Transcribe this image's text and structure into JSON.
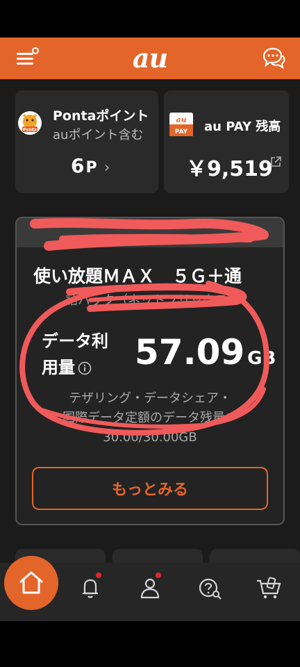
{
  "header": {
    "logo": "au",
    "menu_icon": "hamburger-menu-icon",
    "chat_icon": "chat-bubbles-icon"
  },
  "ponta": {
    "title": "Pontaポイント",
    "subtitle": "auポイント含む",
    "points": "6",
    "unit": "P",
    "chevron": "›",
    "icon_label": "Ponta"
  },
  "aupay": {
    "title": "au PAY 残高",
    "balance": "￥9,519",
    "icon_top": "au",
    "icon_bottom": "PAY"
  },
  "plan": {
    "name": "使い放題ＭＡＸ　５Ｇ＋通",
    "name_line2": "話パック（ネットフリックス",
    "data_label_line1": "データ利",
    "data_label_line2": "用量",
    "data_value": "57.09",
    "data_unit": "GB",
    "share_note_line1": "テザリング・データシェア・",
    "share_note_line2": "国際データ定額のデータ残量：",
    "share_note_line3": "30.00/30.00GB",
    "more_button": "もっとみる"
  },
  "nav": {
    "items": [
      "home-icon",
      "bell-icon",
      "person-icon",
      "help-search-icon",
      "shopping-cart-icon"
    ]
  },
  "colors": {
    "brand": "#e4652a",
    "background": "#1b1b1b",
    "card": "#2a2a2a",
    "badge": "#e0282a",
    "scribble": "#f05a5a"
  }
}
